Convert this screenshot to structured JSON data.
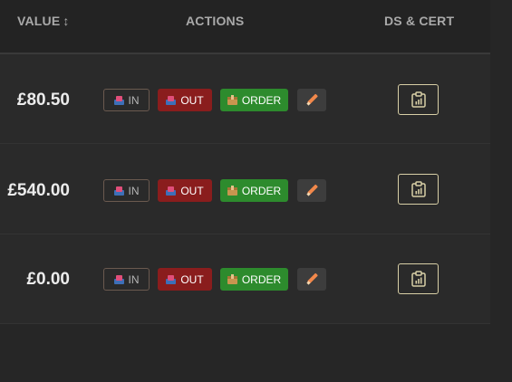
{
  "header": {
    "value_label": "VALUE",
    "sort_glyph": "↕",
    "actions_label": "ACTIONS",
    "ds_label": "DS & CERT"
  },
  "buttons": {
    "in_label": "IN",
    "out_label": "OUT",
    "order_label": "ORDER"
  },
  "icons": {
    "in": "inbox-tray-icon",
    "out": "inbox-tray-icon",
    "order": "package-box-icon",
    "edit": "pencil-icon",
    "ds_cert": "clipboard-chart-icon"
  },
  "colors": {
    "out_bg": "#8a1d1d",
    "order_bg": "#2d8b2d",
    "ds_border": "#d8cfa6"
  },
  "rows": [
    {
      "value": "£80.50"
    },
    {
      "value": "£540.00"
    },
    {
      "value": "£0.00"
    }
  ]
}
